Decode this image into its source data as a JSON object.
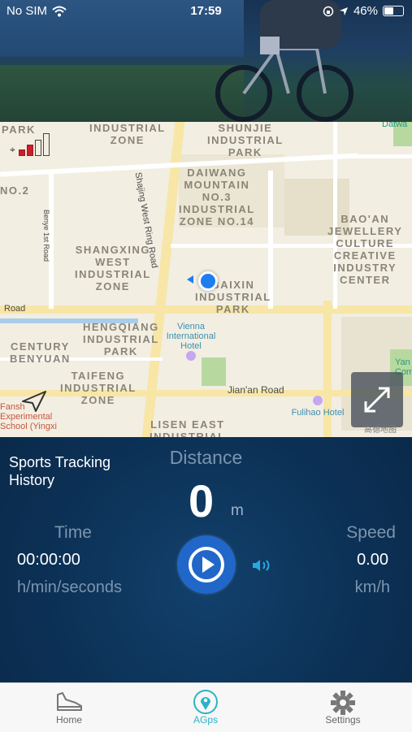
{
  "status_bar": {
    "carrier": "No SIM",
    "time": "17:59",
    "battery": "46%"
  },
  "map": {
    "area_labels": [
      "PARK",
      "INDUSTRIAL\nZONE",
      "SHUNJIE\nINDUSTRIAL\nPARK",
      "DAIWANG\nMOUNTAIN\nNO.3\nINDUSTRIAL\nZONE NO.14",
      "BAO'AN\nJEWELLERY\nCULTURE\nCREATIVE\nINDUSTRY\nCENTER",
      "SHANGXING\nWEST\nINDUSTRIAL\nZONE",
      "BAIXIN\nINDUSTRIAL\nPARK",
      "HENGQIANG\nINDUSTRIAL\nPARK",
      "CENTURY\nBENYUAN",
      "TAIFENG\nINDUSTRIAL\nZONE",
      "LISEN EAST\nINDUSTRIAL",
      "NO.2",
      "Road"
    ],
    "road_labels": {
      "shajing": "Shajing West Ring Road",
      "benye": "Benye 1st Road",
      "jianan": "Jian'an Road",
      "road_left": "Road"
    },
    "pois": {
      "vienna": "Vienna\nInternational\nHotel",
      "fulihao": "Fulihao Hotel",
      "school": "Fansh\nExperimental\nSchool (Yingxi",
      "right_edge": "Yan\nCommu",
      "datwa": "Datwa"
    },
    "attribution": "高德地图",
    "signal_bars_on": 2,
    "signal_bars_total": 4
  },
  "panel": {
    "history_label": "Sports Tracking History",
    "distance_title": "Distance",
    "distance_value": "0",
    "distance_unit": "m",
    "time_title": "Time",
    "time_value": "00:00:00",
    "time_unit": "h/min/seconds",
    "speed_title": "Speed",
    "speed_value": "0.00",
    "speed_unit": "km/h"
  },
  "tabs": [
    {
      "label": "Home",
      "icon": "sneaker-icon",
      "active": false
    },
    {
      "label": "AGps",
      "icon": "location-pin-icon",
      "active": true
    },
    {
      "label": "Settings",
      "icon": "gear-icon",
      "active": false
    }
  ],
  "colors": {
    "panel_bg": "#0d3256",
    "accent": "#2ab3c6",
    "play_button": "#2067c9",
    "you_marker": "#1e7ef0"
  }
}
